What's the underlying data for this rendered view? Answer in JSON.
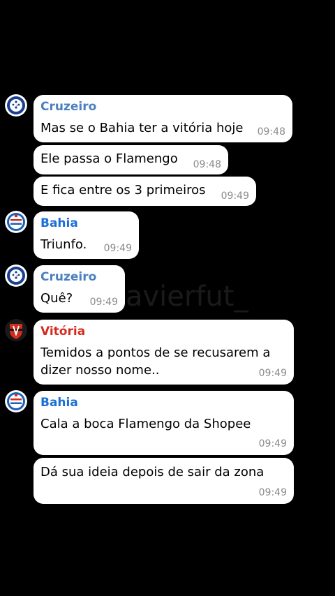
{
  "colors": {
    "background": "#000000",
    "bubble": "#ffffff",
    "time": "#8a8a8a",
    "cruzeiro_name": "#4a7fc1",
    "bahia_name": "#1a6fd6",
    "vitoria_name": "#d52b1e"
  },
  "watermark": "avierfut_",
  "messages": [
    {
      "sender": "Cruzeiro",
      "text": "Mas se o Bahia ter a vitória hoje",
      "time": "09:48",
      "avatar_icon": "cruzeiro-crest-icon"
    },
    {
      "text": "Ele passa o Flamengo",
      "time": "09:48"
    },
    {
      "text": "E fica entre os 3 primeiros",
      "time": "09:49"
    },
    {
      "sender": "Bahia",
      "text": "Triunfo.",
      "time": "09:49",
      "avatar_icon": "bahia-crest-icon"
    },
    {
      "sender": "Cruzeiro",
      "text": "Quê?",
      "time": "09:49",
      "avatar_icon": "cruzeiro-crest-icon"
    },
    {
      "sender": "Vitória",
      "text_line1": "Temidos a pontos de se recusarem a",
      "text_line2": "dizer nosso nome..",
      "time": "09:49",
      "avatar_icon": "vitoria-crest-icon"
    },
    {
      "sender": "Bahia",
      "text": "Cala a boca Flamengo da Shopee",
      "time": "09:49",
      "avatar_icon": "bahia-crest-icon"
    },
    {
      "text": "Dá sua ideia depois de sair da zona",
      "time": "09:49"
    }
  ]
}
